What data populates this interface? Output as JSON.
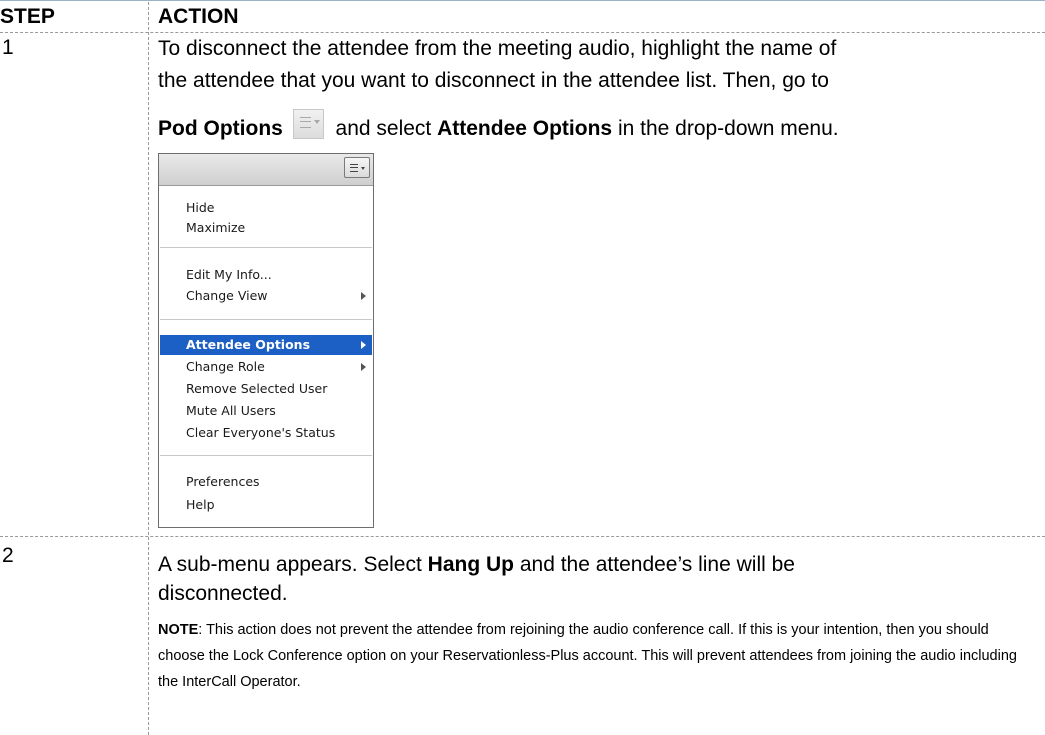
{
  "table": {
    "header_step": "STEP",
    "header_action": "ACTION"
  },
  "step1": {
    "number": "1",
    "line1": "To disconnect the attendee from the meeting audio, highlight the name of",
    "line2": "the attendee that you want to disconnect in the attendee list.  Then, go to",
    "pod_options": "Pod Options",
    "mid_text": " and select ",
    "attendee_options": "Attendee Options",
    "end_text": " in the drop-down menu.",
    "pod_icon": "menu-lines-icon"
  },
  "menu": {
    "button_icon": "menu-lines-icon",
    "items": [
      "Hide",
      "Maximize",
      "Edit My Info...",
      "Change View",
      "Attendee Options",
      "Change Role",
      "Remove Selected User",
      "Mute All Users",
      "Clear Everyone's Status",
      "Preferences",
      "Help"
    ],
    "selected_item": "Attendee Options",
    "highlight_color": "#1c5fc5"
  },
  "step2": {
    "number": "2",
    "text_before": "A sub-menu appears.  Select ",
    "hang_up": "Hang Up",
    "text_after": " and the attendee’s line will be disconnected.",
    "note_label": "NOTE",
    "note_text": ": This action does not prevent the attendee from rejoining the audio conference call.  If this is your intention, then you should choose the Lock Conference option on your Reservationless-Plus account.  This will prevent attendees from joining the audio including the InterCall Operator."
  }
}
